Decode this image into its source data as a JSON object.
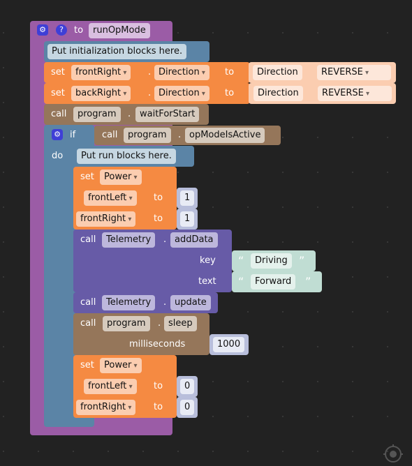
{
  "function": {
    "to_label": "to",
    "name": "runOpMode"
  },
  "init_comment": "Put initialization blocks here.",
  "set_lines": [
    {
      "set": "set",
      "device": "frontRight",
      "property": "Direction",
      "to": "to",
      "enum": "Direction",
      "value": "REVERSE"
    },
    {
      "set": "set",
      "device": "backRight",
      "property": "Direction",
      "to": "to",
      "enum": "Direction",
      "value": "REVERSE"
    }
  ],
  "wait": {
    "call": "call",
    "obj": "program",
    "method": "waitForStart"
  },
  "if_block": {
    "if": "if",
    "do": "do",
    "call": "call",
    "obj": "program",
    "method": "opModeIsActive"
  },
  "run_comment": "Put run blocks here.",
  "power1": {
    "set": "set",
    "var": "Power",
    "l1": "frontLeft",
    "l2": "frontRight",
    "to": "to",
    "v1": "1",
    "v2": "1"
  },
  "add_data": {
    "call": "call",
    "obj": "Telemetry",
    "method": "addData",
    "key_label": "key",
    "text_label": "text",
    "key": "Driving",
    "text": "Forward",
    "open_quote": "“",
    "close_quote": "”"
  },
  "update": {
    "call": "call",
    "obj": "Telemetry",
    "method": "update"
  },
  "sleep": {
    "call": "call",
    "obj": "program",
    "method": "sleep",
    "arg_label": "milliseconds",
    "value": "1000"
  },
  "power2": {
    "set": "set",
    "var": "Power",
    "l1": "frontLeft",
    "l2": "frontRight",
    "to": "to",
    "v1": "0",
    "v2": "0"
  },
  "dot": "."
}
